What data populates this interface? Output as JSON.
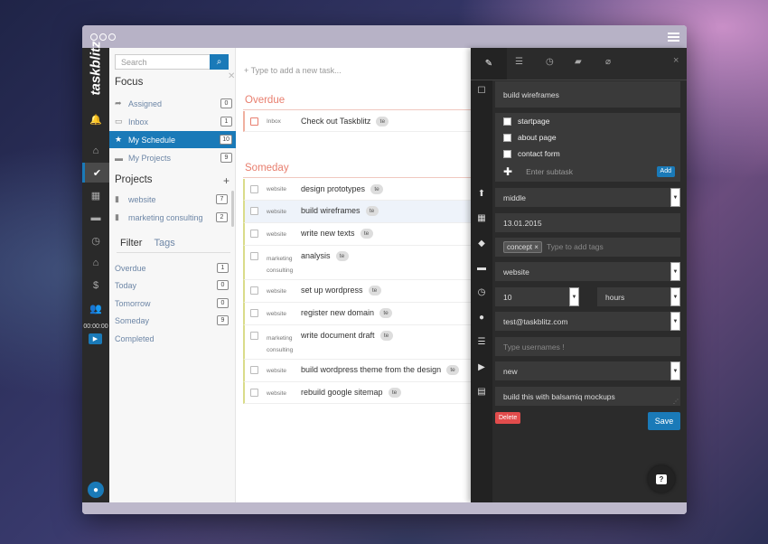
{
  "app": {
    "brand": "taskblitz",
    "timer": "00:00:00"
  },
  "search": {
    "placeholder": "Search"
  },
  "sidebar": {
    "focus_heading": "Focus",
    "focus_items": [
      {
        "label": "Assigned",
        "count": "0"
      },
      {
        "label": "Inbox",
        "count": "1"
      },
      {
        "label": "My Schedule",
        "count": "10"
      },
      {
        "label": "My Projects",
        "count": "9"
      }
    ],
    "projects_heading": "Projects",
    "add_symbol": "+",
    "projects": [
      {
        "label": "website",
        "count": "7"
      },
      {
        "label": "marketing consulting",
        "count": "2"
      }
    ],
    "filter_tab": "Filter",
    "tags_tab": "Tags",
    "filters": [
      {
        "label": "Overdue",
        "count": "1"
      },
      {
        "label": "Today",
        "count": "0"
      },
      {
        "label": "Tomorrow",
        "count": "0"
      },
      {
        "label": "Someday",
        "count": "9"
      },
      {
        "label": "Completed",
        "count": ""
      }
    ]
  },
  "tasklist": {
    "new_task_placeholder": "+ Type to add a new task...",
    "overdue_heading": "Overdue",
    "someday_heading": "Someday",
    "overdue": [
      {
        "project": "Inbox",
        "name": "Check out Taskblitz",
        "tag": "te"
      }
    ],
    "someday": [
      {
        "project": "website",
        "name": "design prototypes",
        "tag": "te"
      },
      {
        "project": "website",
        "name": "build wireframes",
        "tag": "te"
      },
      {
        "project": "website",
        "name": "write new texts",
        "tag": "te"
      },
      {
        "project": "marketing consulting",
        "name": "analysis",
        "tag": "te"
      },
      {
        "project": "website",
        "name": "set up wordpress",
        "tag": "te"
      },
      {
        "project": "website",
        "name": "register new domain",
        "tag": "te"
      },
      {
        "project": "marketing consulting",
        "name": "write document draft",
        "tag": "te"
      },
      {
        "project": "website",
        "name": "build wordpress theme from the design",
        "tag": "te"
      },
      {
        "project": "website",
        "name": "rebuild google sitemap",
        "tag": "te"
      }
    ]
  },
  "detail": {
    "close_symbol": "×",
    "title": "build wireframes",
    "subtasks": [
      "startpage",
      "about page",
      "contact form"
    ],
    "subtask_placeholder": "Enter subtask",
    "add_label": "Add",
    "priority": "middle",
    "date": "13.01.2015",
    "tag": "concept",
    "tag_remove": "×",
    "tags_placeholder": "Type to add tags",
    "project": "website",
    "duration_value": "10",
    "duration_unit": "hours",
    "assignee": "test@taskblitz.com",
    "usernames_placeholder": "Type usernames !",
    "status": "new",
    "notes": "build this with balsamiq mockups",
    "delete_label": "Delete",
    "save_label": "Save",
    "help_symbol": "?"
  }
}
